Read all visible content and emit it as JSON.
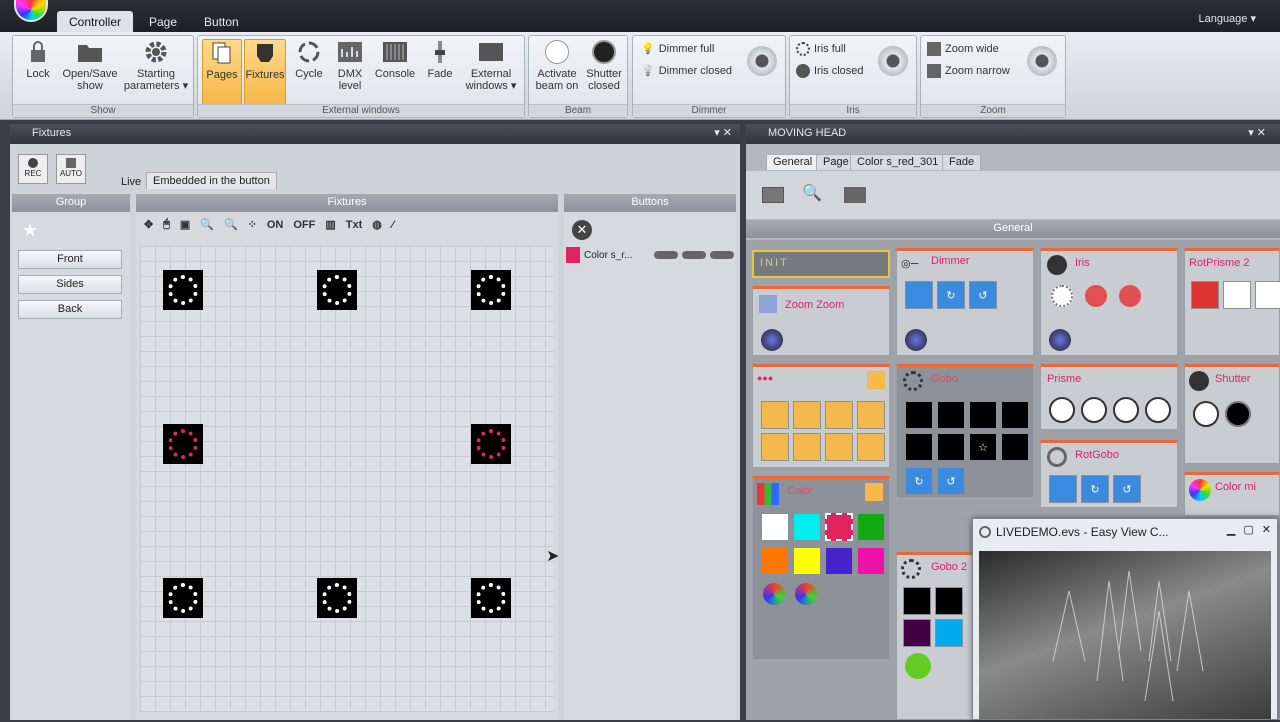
{
  "menu": {
    "tabs": [
      "Controller",
      "Page",
      "Button"
    ],
    "language": "Language ▾"
  },
  "ribbon": {
    "show": {
      "label": "Show",
      "buttons": [
        "Lock",
        "Open/Save show",
        "Starting parameters ▾"
      ]
    },
    "external": {
      "label": "External windows",
      "buttons": [
        "Pages",
        "Fixtures",
        "Cycle",
        "DMX level",
        "Console",
        "Fade",
        "External windows ▾"
      ]
    },
    "beam": {
      "label": "Beam",
      "buttons": [
        "Activate beam on",
        "Shutter closed"
      ]
    },
    "dimmer": {
      "label": "Dimmer",
      "items": [
        "Dimmer full",
        "Dimmer closed"
      ]
    },
    "iris": {
      "label": "Iris",
      "items": [
        "Iris full",
        "Iris closed"
      ]
    },
    "zoom": {
      "label": "Zoom",
      "items": [
        "Zoom wide",
        "Zoom narrow"
      ]
    }
  },
  "fixtures_panel": {
    "title": "Fixtures",
    "rec": "REC",
    "auto": "AUTO",
    "tabs": [
      "Live",
      "Embedded in the button"
    ],
    "group": {
      "header": "Group",
      "items": [
        "Front",
        "Sides",
        "Back"
      ]
    },
    "fixtures": {
      "header": "Fixtures",
      "on": "ON",
      "off": "OFF",
      "txt": "Txt"
    },
    "buttons": {
      "header": "Buttons",
      "item": "Color s_r..."
    }
  },
  "moving_head": {
    "title": "MOVING HEAD",
    "tabs": [
      "General",
      "Page",
      "Color s_red_301",
      "Fade"
    ],
    "section": "General",
    "tiles": {
      "init": "INIT",
      "dimmer": "Dimmer",
      "iris": "Iris",
      "rotprisme": "RotPrisme 2",
      "zoom": "Zoom Zoom",
      "gobo": "Gobo",
      "prisme": "Prisme",
      "shutter": "Shutter",
      "rotgobo": "RotGobo",
      "color": "Color",
      "colormix": "Color mi",
      "gobo2": "Gobo 2"
    }
  },
  "livedemo": {
    "title": "LIVEDEMO.evs - Easy View   C..."
  }
}
